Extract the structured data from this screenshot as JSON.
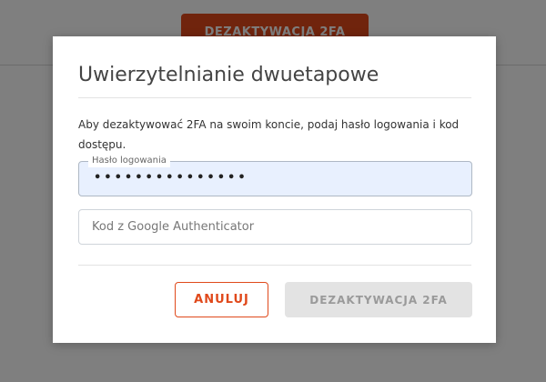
{
  "background": {
    "action_button_label": "DEZAKTYWACJA 2FA"
  },
  "modal": {
    "title": "Uwierzytelnianie dwuetapowe",
    "description": "Aby dezaktywować 2FA na swoim koncie, podaj hasło logowania i kod dostępu.",
    "password_field": {
      "label": "Hasło logowania",
      "masked_value": "•••••••••••••••"
    },
    "code_field": {
      "placeholder": "Kod z Google Authenticator",
      "value": ""
    },
    "cancel_label": "ANULUJ",
    "deactivate_label": "DEZAKTYWACJA 2FA"
  },
  "colors": {
    "accent": "#e0491b",
    "overlay": "rgba(0,0,0,0.5)",
    "disabled_button": "#e3e3e3",
    "autofill_bg": "#e8f0fe"
  }
}
